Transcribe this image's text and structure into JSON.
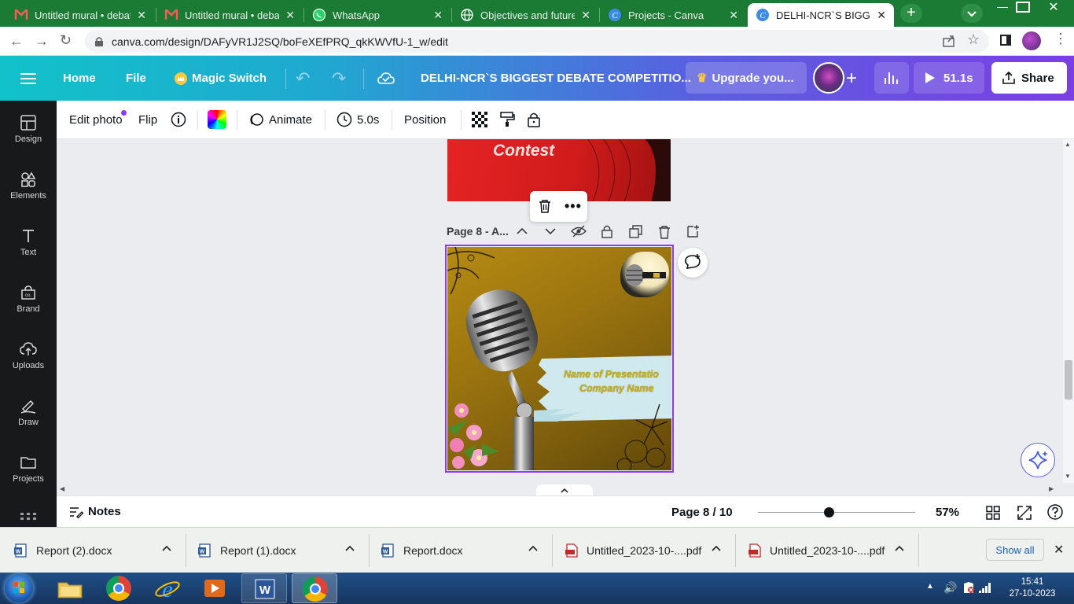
{
  "browser": {
    "tabs": [
      {
        "label": "Untitled mural • debate",
        "icon": "mural-icon",
        "active": false
      },
      {
        "label": "Untitled mural • debate",
        "icon": "mural-icon",
        "active": false
      },
      {
        "label": "WhatsApp",
        "icon": "whatsapp-icon",
        "active": false
      },
      {
        "label": "Objectives and future p",
        "icon": "globe-icon",
        "active": false
      },
      {
        "label": "Projects - Canva",
        "icon": "canva-icon",
        "active": false
      },
      {
        "label": "DELHI-NCR`S BIGGEST",
        "icon": "canva-icon",
        "active": true
      }
    ],
    "url": "canva.com/design/DAFyVR1J2SQ/boFeXEfPRQ_qkKWVfU-1_w/edit"
  },
  "header": {
    "home": "Home",
    "file": "File",
    "magic_switch": "Magic Switch",
    "title": "DELHI-NCR`S BIGGEST DEBATE COMPETITIO...",
    "upgrade": "Upgrade you...",
    "present_time": "51.1s",
    "share": "Share"
  },
  "sidebar": {
    "items": [
      {
        "label": "Design",
        "icon": "design-icon"
      },
      {
        "label": "Elements",
        "icon": "elements-icon"
      },
      {
        "label": "Text",
        "icon": "text-icon"
      },
      {
        "label": "Brand",
        "icon": "brand-icon"
      },
      {
        "label": "Uploads",
        "icon": "uploads-icon"
      },
      {
        "label": "Draw",
        "icon": "draw-icon"
      },
      {
        "label": "Projects",
        "icon": "projects-icon"
      }
    ]
  },
  "toolbar": {
    "edit_photo": "Edit photo",
    "flip": "Flip",
    "animate": "Animate",
    "duration": "5.0s",
    "position": "Position"
  },
  "canvas": {
    "prev_page_text": "Contest",
    "page_label": "Page 8 - A...",
    "presentation_name": "Name of Presentatio",
    "company_name": "Company Name"
  },
  "footer": {
    "notes": "Notes",
    "page_indicator": "Page 8 / 10",
    "zoom": "57%",
    "zoom_fraction": 0.45
  },
  "downloads": {
    "items": [
      {
        "name": "Report (2).docx",
        "type": "docx"
      },
      {
        "name": "Report (1).docx",
        "type": "docx"
      },
      {
        "name": "Report.docx",
        "type": "docx"
      },
      {
        "name": "Untitled_2023-10-....pdf",
        "type": "pdf"
      },
      {
        "name": "Untitled_2023-10-....pdf",
        "type": "pdf"
      }
    ],
    "show_all": "Show all"
  },
  "taskbar": {
    "time": "15:41",
    "date": "27-10-2023"
  },
  "colors": {
    "chrome_frame": "#1b7a34",
    "canva_gradient_start": "#12c2c9",
    "canva_gradient_end": "#7b3fe4",
    "selection": "#8b3dff",
    "sidebar_bg": "#18191b"
  }
}
